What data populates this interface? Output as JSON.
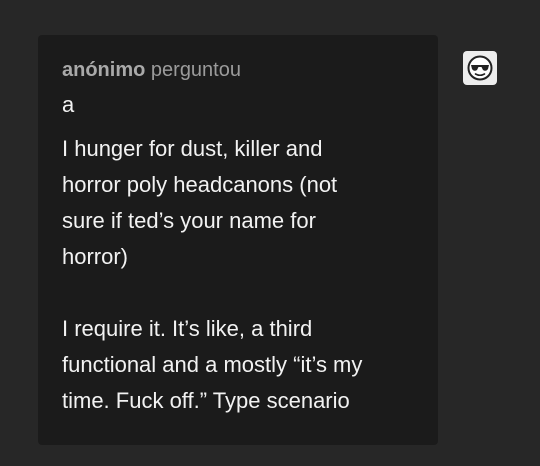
{
  "post": {
    "asker_name": "anónimo",
    "asked_verb": "perguntou",
    "question_paragraphs": [
      "a",
      "I hunger for dust, killer and\nhorror poly headcanons (not\nsure if ted’s your name for\nhorror)",
      "I require it. It’s like, a third\nfunctional and a mostly “it’s my\ntime. Fuck off.” Type scenario"
    ]
  },
  "avatar": {
    "icon": "anonymous-sunglasses-face-icon"
  },
  "colors": {
    "page_background": "#272727",
    "card_background": "#1b1b1b",
    "question_text": "#f2f2f2",
    "meta_text": "#9b9b9b"
  }
}
